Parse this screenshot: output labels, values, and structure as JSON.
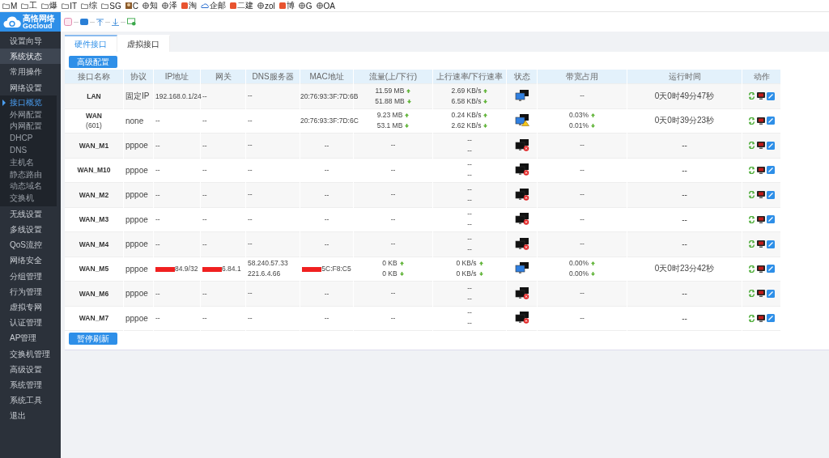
{
  "bookmarks": [
    {
      "label": "M",
      "kind": "folder"
    },
    {
      "label": "工",
      "kind": "folder"
    },
    {
      "label": "爆",
      "kind": "folder"
    },
    {
      "label": "IT",
      "kind": "folder"
    },
    {
      "label": "综",
      "kind": "folder"
    },
    {
      "label": "SG",
      "kind": "folder"
    },
    {
      "label": "C",
      "kind": "image"
    },
    {
      "label": "知",
      "kind": "globe"
    },
    {
      "label": "泽",
      "kind": "globe"
    },
    {
      "label": "淘",
      "kind": "badge"
    },
    {
      "label": "企邮",
      "kind": "cloud"
    },
    {
      "label": "二建",
      "kind": "badge"
    },
    {
      "label": "zol",
      "kind": "globe"
    },
    {
      "label": "博",
      "kind": "badge"
    },
    {
      "label": "G",
      "kind": "globe"
    },
    {
      "label": "OA",
      "kind": "globe"
    }
  ],
  "logo": {
    "name": "高恪网络",
    "subtitle": "Gocloud"
  },
  "sidebar": [
    {
      "label": "设置向导",
      "selected": false
    },
    {
      "label": "系统状态",
      "selected": true
    },
    {
      "label": "常用操作",
      "selected": false
    },
    {
      "label": "网络设置",
      "selected": false,
      "expanded": true,
      "children": [
        {
          "label": "接口概览",
          "selected": true
        },
        {
          "label": "外网配置",
          "selected": false
        },
        {
          "label": "内网配置",
          "selected": false
        },
        {
          "label": "DHCP",
          "selected": false
        },
        {
          "label": "DNS",
          "selected": false
        },
        {
          "label": "主机名",
          "selected": false
        },
        {
          "label": "静态路由",
          "selected": false
        },
        {
          "label": "动态域名",
          "selected": false
        },
        {
          "label": "交换机",
          "selected": false
        }
      ]
    },
    {
      "label": "无线设置",
      "selected": false
    },
    {
      "label": "多线设置",
      "selected": false
    },
    {
      "label": "QoS流控",
      "selected": false
    },
    {
      "label": "网络安全",
      "selected": false
    },
    {
      "label": "分组管理",
      "selected": false
    },
    {
      "label": "行为管理",
      "selected": false
    },
    {
      "label": "虚拟专网",
      "selected": false
    },
    {
      "label": "认证管理",
      "selected": false
    },
    {
      "label": "AP管理",
      "selected": false
    },
    {
      "label": "交换机管理",
      "selected": false
    },
    {
      "label": "高级设置",
      "selected": false
    },
    {
      "label": "系统管理",
      "selected": false
    },
    {
      "label": "系统工具",
      "selected": false
    },
    {
      "label": "退出",
      "selected": false
    }
  ],
  "tabs": [
    {
      "label": "硬件接口",
      "selected": true
    },
    {
      "label": "虚拟接口",
      "selected": false
    }
  ],
  "advanced_button": "高级配置",
  "table": {
    "columns": [
      "接口名称",
      "协议",
      "IP地址",
      "网关",
      "DNS服务器",
      "MAC地址",
      "流量(上/下行)",
      "上行速率/下行速率",
      "状态",
      "带宽占用",
      "运行时间",
      "动作"
    ],
    "rows": [
      {
        "name": "LAN",
        "protocol": "固定IP",
        "ip": "192.168.0.1/24",
        "gateway": "--",
        "dns": [
          "--"
        ],
        "mac": "20:76:93:3F:7D:6B",
        "traffic": [
          "11.59 MB",
          "51.88 MB"
        ],
        "rate": [
          "2.69 KB/s",
          "6.58 KB/s"
        ],
        "kind": "connected",
        "bandwidth": [
          "--"
        ],
        "uptime": "0天0时49分47秒",
        "live": true,
        "redacted": false
      },
      {
        "name": "WAN",
        "sub": "(601)",
        "protocol": "none",
        "ip": "--",
        "gateway": "--",
        "dns": [
          "--"
        ],
        "mac": "20:76:93:3F:7D:6C",
        "traffic": [
          "9.23 MB",
          "53.1 MB"
        ],
        "rate": [
          "0.24 KB/s",
          "2.62 KB/s"
        ],
        "kind": "warning",
        "bandwidth": [
          "0.03%",
          "0.01%"
        ],
        "uptime": "0天0时39分23秒",
        "live": true,
        "redacted": false
      },
      {
        "name": "WAN_M1",
        "protocol": "pppoe",
        "ip": "--",
        "gateway": "--",
        "dns": [
          "--"
        ],
        "mac": "--",
        "traffic": [
          "--"
        ],
        "rate": [
          "--",
          "--"
        ],
        "kind": "down",
        "bandwidth": [
          "--"
        ],
        "uptime": "--",
        "live": false,
        "redacted": false
      },
      {
        "name": "WAN_M10",
        "protocol": "pppoe",
        "ip": "--",
        "gateway": "--",
        "dns": [
          "--"
        ],
        "mac": "--",
        "traffic": [
          "--"
        ],
        "rate": [
          "--",
          "--"
        ],
        "kind": "down",
        "bandwidth": [
          "--"
        ],
        "uptime": "--",
        "live": false,
        "redacted": false
      },
      {
        "name": "WAN_M2",
        "protocol": "pppoe",
        "ip": "--",
        "gateway": "--",
        "dns": [
          "--"
        ],
        "mac": "--",
        "traffic": [
          "--"
        ],
        "rate": [
          "--",
          "--"
        ],
        "kind": "down",
        "bandwidth": [
          "--"
        ],
        "uptime": "--",
        "live": false,
        "redacted": false
      },
      {
        "name": "WAN_M3",
        "protocol": "pppoe",
        "ip": "--",
        "gateway": "--",
        "dns": [
          "--"
        ],
        "mac": "--",
        "traffic": [
          "--"
        ],
        "rate": [
          "--",
          "--"
        ],
        "kind": "down",
        "bandwidth": [
          "--"
        ],
        "uptime": "--",
        "live": false,
        "redacted": false
      },
      {
        "name": "WAN_M4",
        "protocol": "pppoe",
        "ip": "--",
        "gateway": "--",
        "dns": [
          "--"
        ],
        "mac": "--",
        "traffic": [
          "--"
        ],
        "rate": [
          "--",
          "--"
        ],
        "kind": "down",
        "bandwidth": [
          "--"
        ],
        "uptime": "--",
        "live": false,
        "redacted": false
      },
      {
        "name": "WAN_M5",
        "protocol": "pppoe",
        "ip": "84.9/32",
        "gateway": "6.84.1",
        "dns": [
          "58.240.57.33",
          "221.6.4.66"
        ],
        "mac": "5C:F8:C5",
        "traffic": [
          "0 KB",
          "0 KB"
        ],
        "rate": [
          "0 KB/s",
          "0 KB/s"
        ],
        "kind": "connected",
        "bandwidth": [
          "0.00%",
          "0.00%"
        ],
        "uptime": "0天0时23分42秒",
        "live": true,
        "redacted": true
      },
      {
        "name": "WAN_M6",
        "protocol": "pppoe",
        "ip": "--",
        "gateway": "--",
        "dns": [
          "--"
        ],
        "mac": "--",
        "traffic": [
          "--"
        ],
        "rate": [
          "--",
          "--"
        ],
        "kind": "down",
        "bandwidth": [
          "--"
        ],
        "uptime": "--",
        "live": false,
        "redacted": false
      },
      {
        "name": "WAN_M7",
        "protocol": "pppoe",
        "ip": "--",
        "gateway": "--",
        "dns": [
          "--"
        ],
        "mac": "--",
        "traffic": [
          "--"
        ],
        "rate": [
          "--",
          "--"
        ],
        "kind": "down",
        "bandwidth": [
          "--"
        ],
        "uptime": "--",
        "live": false,
        "redacted": false
      }
    ]
  },
  "pause_button": "暂停刷新"
}
